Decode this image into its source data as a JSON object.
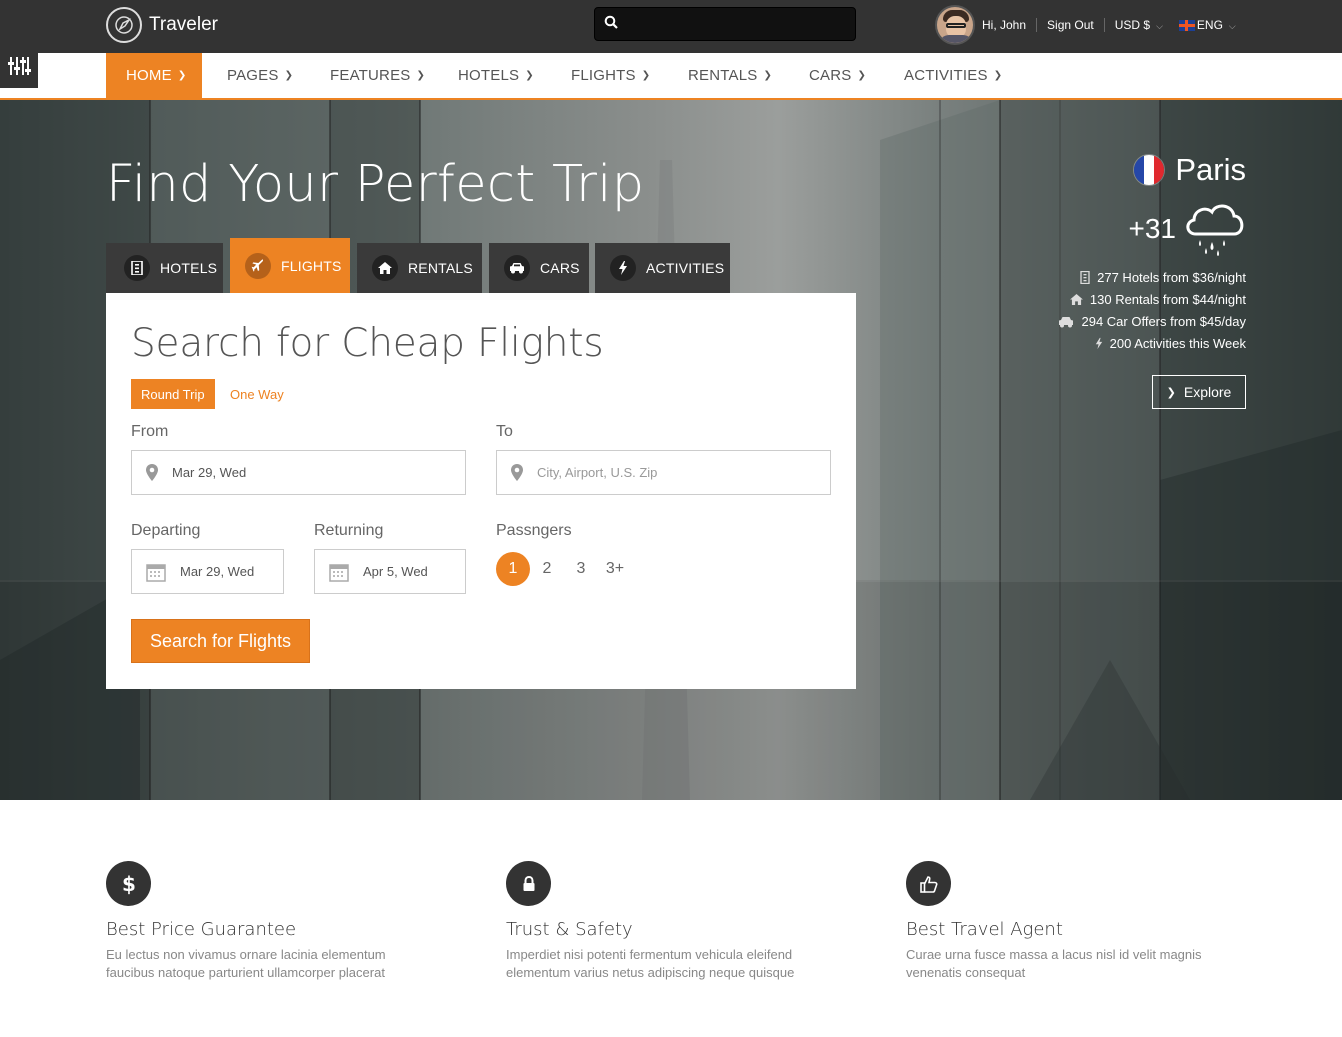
{
  "topbar": {
    "brand": "Traveler",
    "search_placeholder": "",
    "greeting": "Hi, John",
    "sign_out": "Sign Out",
    "currency": "USD $",
    "language": "ENG"
  },
  "nav": {
    "items": [
      {
        "label": "HOME",
        "active": true
      },
      {
        "label": "PAGES"
      },
      {
        "label": "FEATURES"
      },
      {
        "label": "HOTELS"
      },
      {
        "label": "FLIGHTS"
      },
      {
        "label": "RENTALS"
      },
      {
        "label": "CARS"
      },
      {
        "label": "ACTIVITIES"
      }
    ]
  },
  "hero": {
    "title": "Find Your Perfect Trip",
    "tabs": [
      {
        "label": "HOTELS",
        "icon": "building-icon"
      },
      {
        "label": "FLIGHTS",
        "icon": "plane-icon",
        "active": true
      },
      {
        "label": "RENTALS",
        "icon": "home-icon"
      },
      {
        "label": "CARS",
        "icon": "car-icon"
      },
      {
        "label": "ACTIVITIES",
        "icon": "bolt-icon"
      }
    ]
  },
  "search": {
    "title": "Search for Cheap Flights",
    "round_trip": "Round Trip",
    "one_way": "One Way",
    "from_label": "From",
    "from_value": "Mar 29, Wed",
    "to_label": "To",
    "to_placeholder": "City, Airport, U.S. Zip",
    "departing_label": "Departing",
    "departing_value": "Mar 29, Wed",
    "returning_label": "Returning",
    "returning_value": "Apr 5, Wed",
    "passengers_label": "Passngers",
    "passengers": [
      "1",
      "2",
      "3",
      "3+"
    ],
    "passengers_selected": "1",
    "submit": "Search for Flights"
  },
  "destination": {
    "city": "Paris",
    "temperature": "+31",
    "stats": [
      "277 Hotels from $36/night",
      "130 Rentals from $44/night",
      "294 Car Offers from $45/day",
      "200 Activities this Week"
    ],
    "explore": "Explore"
  },
  "features": [
    {
      "icon": "dollar-icon",
      "title": "Best Price Guarantee",
      "text_1": "Eu lectus non vivamus ornare lacinia elementum",
      "text_2": "faucibus natoque parturient ullamcorper placerat"
    },
    {
      "icon": "lock-icon",
      "title": "Trust & Safety",
      "text_1": "Imperdiet nisi potenti fermentum vehicula eleifend",
      "text_2": "elementum varius netus adipiscing neque quisque"
    },
    {
      "icon": "thumbs-up-icon",
      "title": "Best Travel Agent",
      "text_1": "Curae urna fusce massa a lacus nisl id velit magnis",
      "text_2": "venenatis consequat"
    }
  ],
  "colors": {
    "accent": "#ed8323",
    "topbar": "#333333",
    "tab_dark": "#3a3a3a"
  }
}
